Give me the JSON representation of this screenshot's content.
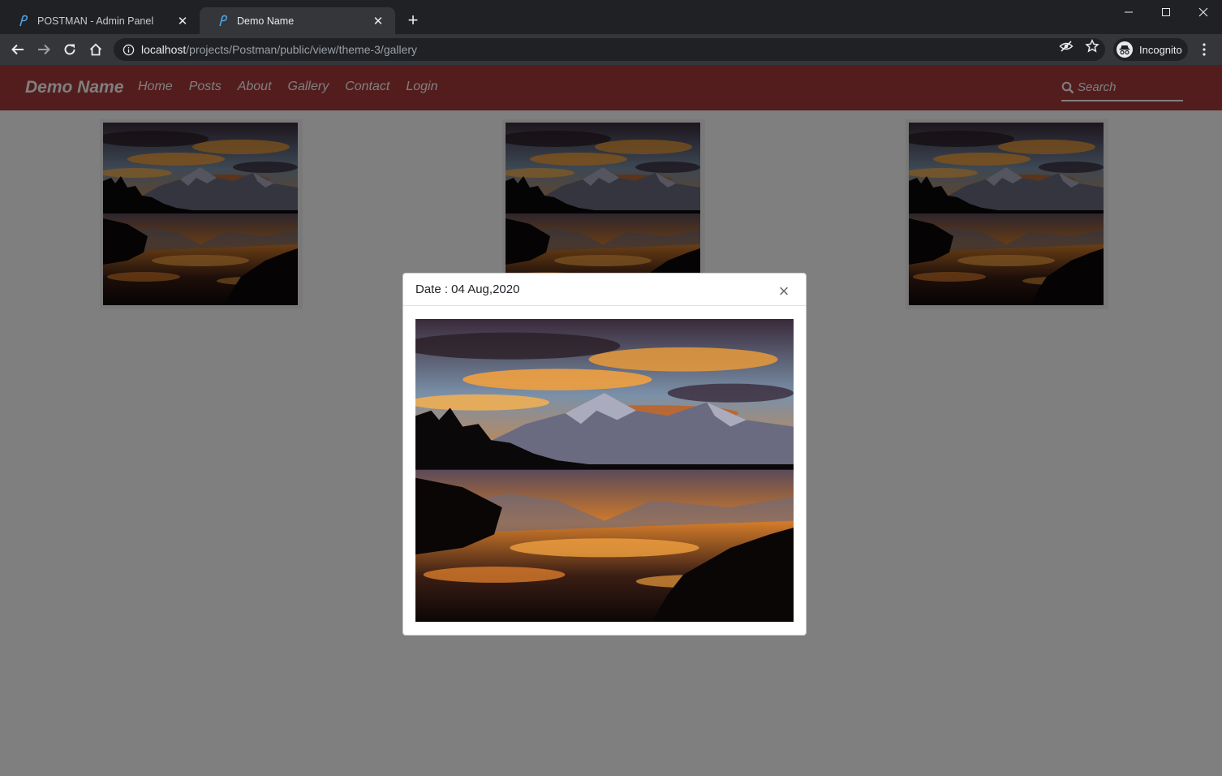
{
  "browser": {
    "tabs": [
      {
        "title": "POSTMAN - Admin Panel",
        "active": false
      },
      {
        "title": "Demo Name",
        "active": true
      }
    ],
    "address": {
      "host": "localhost",
      "path": "/projects/Postman/public/view/theme-3/gallery"
    },
    "profile_label": "Incognito"
  },
  "site": {
    "brand": "Demo Name",
    "nav": [
      "Home",
      "Posts",
      "About",
      "Gallery",
      "Contact",
      "Login"
    ],
    "search_placeholder": "Search",
    "colors": {
      "navbar": "#a83a3a",
      "nav_text": "#ffffff",
      "overlay": "rgba(0,0,0,0.5)"
    }
  },
  "gallery": {
    "images": [
      {
        "alt": "Mountain sunset reflection"
      },
      {
        "alt": "Mountain sunset reflection"
      },
      {
        "alt": "Mountain sunset reflection"
      }
    ]
  },
  "modal": {
    "title": "Date : 04 Aug,2020",
    "close_glyph": "×"
  }
}
